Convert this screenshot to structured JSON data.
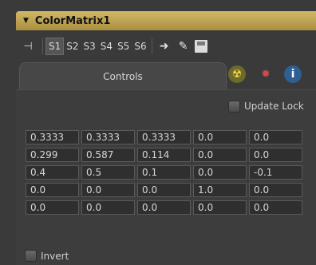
{
  "header": {
    "title": "ColorMatrix1"
  },
  "toolbar": {
    "slots": [
      "S1",
      "S2",
      "S3",
      "S4",
      "S5",
      "S6"
    ],
    "active_slot": "S1"
  },
  "tabs": {
    "controls_label": "Controls"
  },
  "controls": {
    "update_lock_label": "Update Lock",
    "invert_label": "Invert",
    "matrix": [
      [
        "0.3333",
        "0.3333",
        "0.3333",
        "0.0",
        "0.0"
      ],
      [
        "0.299",
        "0.587",
        "0.114",
        "0.0",
        "0.0"
      ],
      [
        "0.4",
        "0.5",
        "0.1",
        "0.0",
        "-0.1"
      ],
      [
        "0.0",
        "0.0",
        "0.0",
        "1.0",
        "0.0"
      ],
      [
        "0.0",
        "0.0",
        "0.0",
        "0.0",
        "0.0"
      ]
    ]
  },
  "icons": {
    "collapse": "triangle-down-icon",
    "pin": "pin-icon",
    "link": "link-arrow-icon",
    "picker": "picker-icon",
    "save": "save-icon",
    "radioactive": "radioactive-icon",
    "settings": "gear-icon",
    "info": "info-icon"
  },
  "colors": {
    "header_gold": "#c8ac55",
    "panel_bg": "#3a3a3a"
  }
}
